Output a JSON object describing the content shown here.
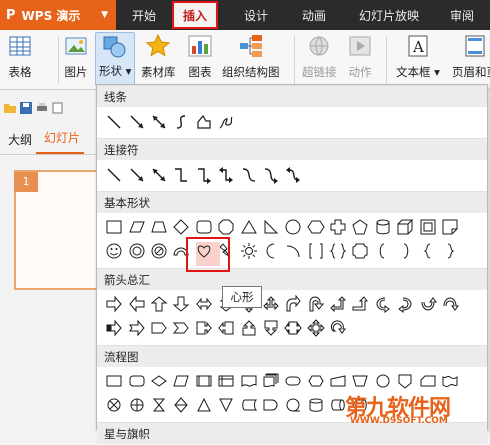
{
  "app": {
    "logo": "P",
    "name": "WPS 演示",
    "caret": "▼"
  },
  "menus": [
    "开始",
    "插入",
    "设计",
    "动画",
    "幻灯片放映",
    "审阅"
  ],
  "active_menu": "插入",
  "ribbon": {
    "table": "表格",
    "picture": "图片",
    "shape": "形状",
    "clipart": "素材库",
    "chart": "图表",
    "org": "组织结构图",
    "hyperlink": "超链接",
    "action": "动作",
    "textbox": "文本框",
    "header": "页眉和页"
  },
  "left": {
    "tab_outline": "大纲",
    "tab_slides": "幻灯片",
    "slide_number": "1"
  },
  "sections": {
    "lines": "线条",
    "connectors": "连接符",
    "basic": "基本形状",
    "arrows": "箭头总汇",
    "flowchart": "流程图",
    "stars": "星与旗帜"
  },
  "tooltip": "心形",
  "watermark": {
    "main": "第九软件网",
    "sub": "WWW.D9SOFT.COM"
  },
  "colors": {
    "brand": "#e8631a",
    "highlight": "#e31414",
    "topbar": "#2b2b2b"
  }
}
